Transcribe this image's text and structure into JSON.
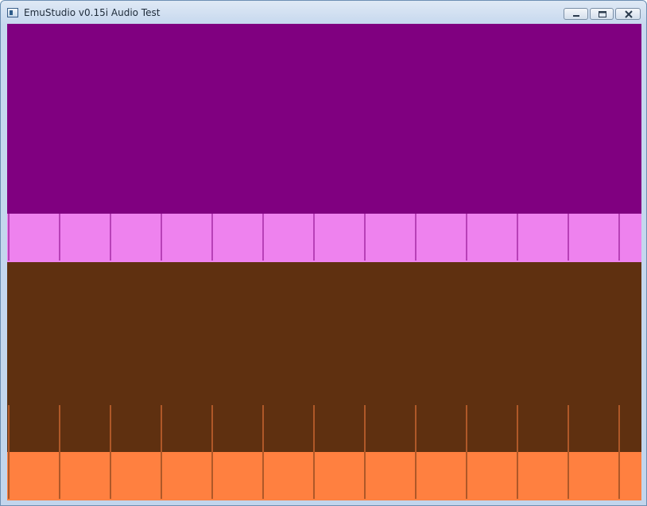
{
  "window": {
    "title": "EmuStudio v0.15i Audio Test",
    "icon": "app-window-icon",
    "controls": {
      "minimize_icon": "minimize-icon",
      "maximize_icon": "maximize-icon",
      "close_icon": "close-icon"
    }
  },
  "channels": [
    {
      "name_key": "channel-1",
      "background": "#800080",
      "wave": "#ee82ee"
    },
    {
      "name_key": "channel-2",
      "background": "#5f3010",
      "wave": "#ff8040"
    }
  ],
  "colors": {
    "titlebar": "#c6d8ee",
    "channel1_bg": "#800080",
    "channel1_wave": "#ee82ee",
    "channel2_bg": "#5f3010",
    "channel2_wave": "#ff8040"
  }
}
